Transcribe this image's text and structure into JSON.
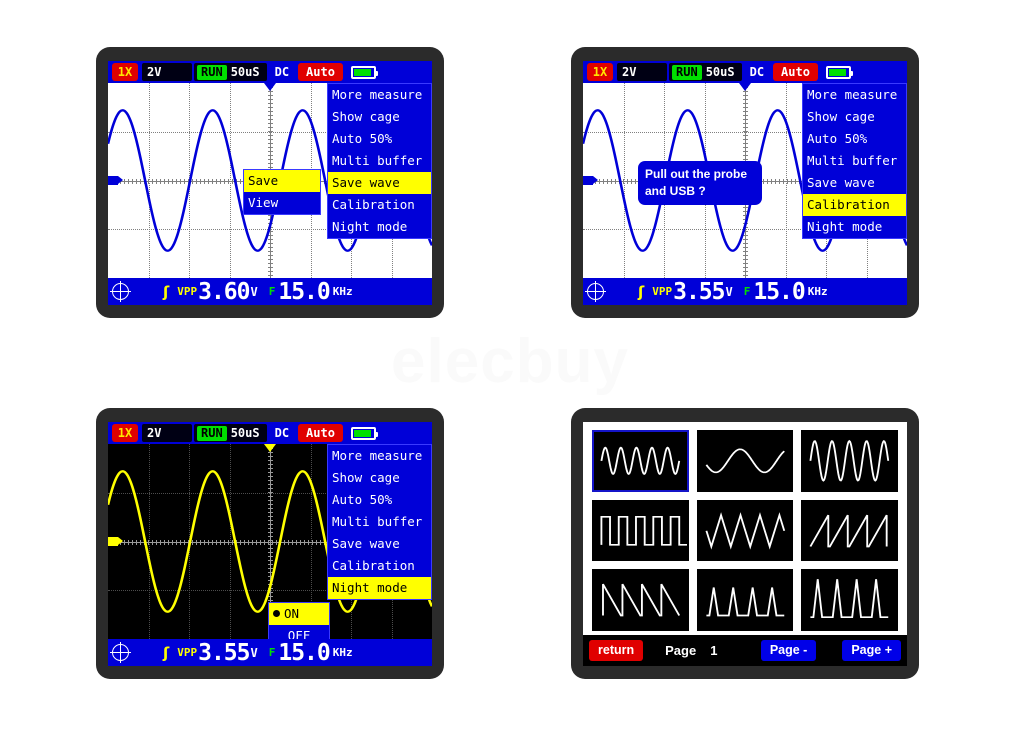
{
  "watermark": "elecbuy",
  "panels": [
    {
      "id": "panel-save-wave",
      "topbar": {
        "probe": "1X",
        "volts_div": "2V",
        "run_state": "RUN",
        "time_div": "50uS",
        "coupling": "DC",
        "trigger_mode": "Auto",
        "battery_icon": "battery-icon"
      },
      "measure": {
        "position_icon": "crosshair-icon",
        "trigger_icon": "rising-edge-icon",
        "vpp_label": "VPP",
        "vpp_value": "3.60",
        "vpp_unit": "V",
        "freq_label": "F",
        "freq_value": "15.0",
        "freq_unit": "KHz"
      },
      "menu": [
        {
          "label": "More measure",
          "highlighted": false
        },
        {
          "label": "Show cage",
          "highlighted": false
        },
        {
          "label": "Auto 50%",
          "highlighted": false
        },
        {
          "label": "Multi buffer",
          "highlighted": false
        },
        {
          "label": "Save wave",
          "highlighted": true
        },
        {
          "label": "Calibration",
          "highlighted": false
        },
        {
          "label": "Night mode",
          "highlighted": false
        }
      ],
      "submenu": [
        {
          "label": "Save",
          "highlighted": true
        },
        {
          "label": "View",
          "highlighted": false
        }
      ],
      "waveform": {
        "color": "#0000d8",
        "background": "#ffffff",
        "cycles": 3.6,
        "amplitude": 0.72
      }
    },
    {
      "id": "panel-calibration",
      "topbar": {
        "probe": "1X",
        "volts_div": "2V",
        "run_state": "RUN",
        "time_div": "50uS",
        "coupling": "DC",
        "trigger_mode": "Auto",
        "battery_icon": "battery-icon"
      },
      "measure": {
        "position_icon": "crosshair-icon",
        "trigger_icon": "rising-edge-icon",
        "vpp_label": "VPP",
        "vpp_value": "3.55",
        "vpp_unit": "V",
        "freq_label": "F",
        "freq_value": "15.0",
        "freq_unit": "KHz"
      },
      "menu": [
        {
          "label": "More measure",
          "highlighted": false
        },
        {
          "label": "Show cage",
          "highlighted": false
        },
        {
          "label": "Auto 50%",
          "highlighted": false
        },
        {
          "label": "Multi buffer",
          "highlighted": false
        },
        {
          "label": "Save wave",
          "highlighted": false
        },
        {
          "label": "Calibration",
          "highlighted": true
        },
        {
          "label": "Night mode",
          "highlighted": false
        }
      ],
      "dialog": {
        "line1": "Pull out the probe",
        "line2": "and USB ?"
      },
      "waveform": {
        "color": "#0000d8",
        "background": "#ffffff",
        "cycles": 3.6,
        "amplitude": 0.72
      }
    },
    {
      "id": "panel-night-mode",
      "topbar": {
        "probe": "1X",
        "volts_div": "2V",
        "run_state": "RUN",
        "time_div": "50uS",
        "coupling": "DC",
        "trigger_mode": "Auto",
        "battery_icon": "battery-icon"
      },
      "measure": {
        "position_icon": "crosshair-icon",
        "trigger_icon": "rising-edge-icon",
        "vpp_label": "VPP",
        "vpp_value": "3.55",
        "vpp_unit": "V",
        "freq_label": "F",
        "freq_value": "15.0",
        "freq_unit": "KHz"
      },
      "menu": [
        {
          "label": "More measure",
          "highlighted": false
        },
        {
          "label": "Show cage",
          "highlighted": false
        },
        {
          "label": "Auto 50%",
          "highlighted": false
        },
        {
          "label": "Multi buffer",
          "highlighted": false
        },
        {
          "label": "Save wave",
          "highlighted": false
        },
        {
          "label": "Calibration",
          "highlighted": false
        },
        {
          "label": "Night mode",
          "highlighted": true
        }
      ],
      "submenu": [
        {
          "label": "ON",
          "highlighted": true,
          "selected": true
        },
        {
          "label": "OFF",
          "highlighted": false,
          "selected": false
        }
      ],
      "waveform": {
        "color": "#ffff00",
        "background": "#000000",
        "cycles": 3.6,
        "amplitude": 0.72
      }
    },
    {
      "id": "panel-wave-gallery",
      "gallery": {
        "thumbnails": [
          {
            "name": "sine-5-cycles",
            "selected": true
          },
          {
            "name": "sine-1-5-cycles",
            "selected": false
          },
          {
            "name": "sine-4-5-cycles-tall",
            "selected": false
          },
          {
            "name": "square-wave",
            "selected": false
          },
          {
            "name": "triangle-wave",
            "selected": false
          },
          {
            "name": "sawtooth-rising",
            "selected": false
          },
          {
            "name": "sawtooth-falling",
            "selected": false
          },
          {
            "name": "narrow-pulse-train",
            "selected": false
          },
          {
            "name": "tall-spike-train",
            "selected": false
          }
        ],
        "return_label": "return",
        "page_label": "Page",
        "page_number": "1",
        "page_prev_label": "Page -",
        "page_next_label": "Page +"
      }
    }
  ],
  "colors": {
    "menu_blue": "#0000d8",
    "highlight_yellow": "#ffff00",
    "run_green": "#00e000",
    "alert_red": "#e00000",
    "probe_text": "#ffe600",
    "night_wave": "#ffff00",
    "day_wave": "#0000d8"
  }
}
